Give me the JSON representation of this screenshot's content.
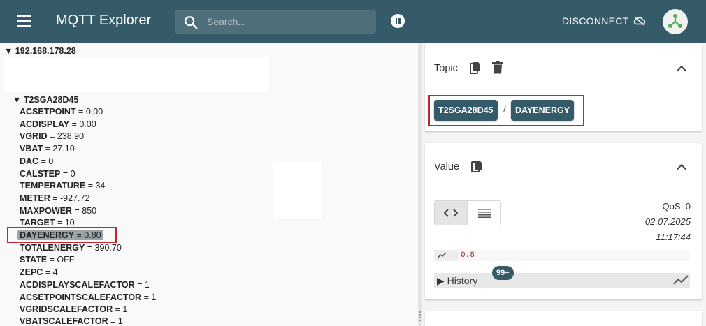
{
  "appbar": {
    "title": "MQTT Explorer",
    "search_placeholder": "Search...",
    "disconnect_label": "DISCONNECT"
  },
  "tree": {
    "root": "▼ 192.168.178.28",
    "node": "▼ T2SGA28D45",
    "items": [
      {
        "key": "ACSETPOINT",
        "value": "0.00"
      },
      {
        "key": "ACDISPLAY",
        "value": "0.00"
      },
      {
        "key": "VGRID",
        "value": "238.90"
      },
      {
        "key": "VBAT",
        "value": "27.10"
      },
      {
        "key": "DAC",
        "value": "0"
      },
      {
        "key": "CALSTEP",
        "value": "0"
      },
      {
        "key": "TEMPERATURE",
        "value": "34"
      },
      {
        "key": "METER",
        "value": "-927.72"
      },
      {
        "key": "MAXPOWER",
        "value": "850"
      },
      {
        "key": "TARGET",
        "value": "10"
      },
      {
        "key": "DAYENERGY",
        "value": "0.80"
      },
      {
        "key": "TOTALENERGY",
        "value": "390.70"
      },
      {
        "key": "STATE",
        "value": "OFF"
      },
      {
        "key": "ZEPC",
        "value": "4"
      },
      {
        "key": "ACDISPLAYSCALEFACTOR",
        "value": "1"
      },
      {
        "key": "ACSETPOINTSCALEFACTOR",
        "value": "1"
      },
      {
        "key": "VGRIDSCALEFACTOR",
        "value": "1"
      },
      {
        "key": "VBATSCALEFACTOR",
        "value": "1"
      }
    ],
    "separator": " = "
  },
  "topic": {
    "label": "Topic",
    "segments": [
      "T2SGA28D45",
      "DAYENERGY"
    ],
    "separator": "/"
  },
  "value": {
    "label": "Value",
    "qos": "QoS: 0",
    "date": "02.07.2025",
    "time": "11:17:44",
    "payload": "0.8",
    "history_label": "History",
    "history_count": "99+"
  },
  "colors": {
    "appbar": "#355a68",
    "highlight_border": "#c0262d",
    "selected_bg": "#9aa4a8"
  }
}
